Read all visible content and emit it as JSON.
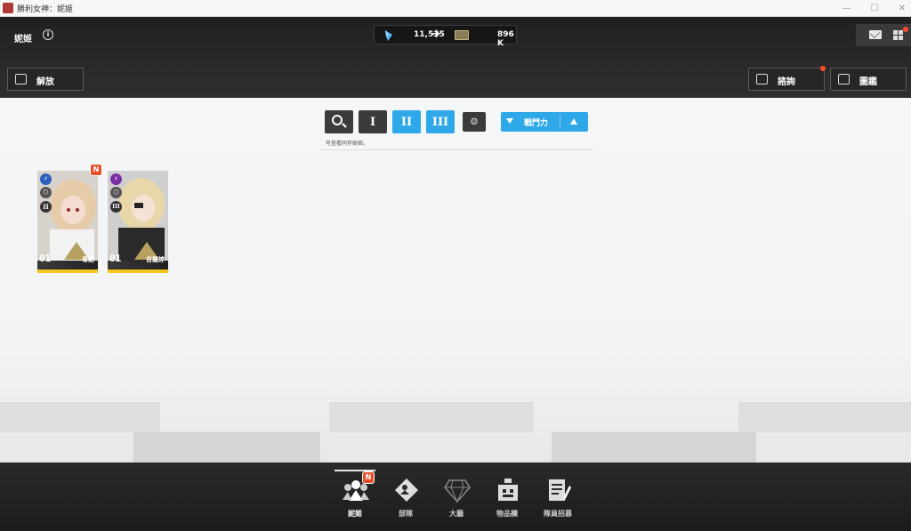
{
  "window": {
    "title": "勝利女神：妮姬"
  },
  "header": {
    "page_name": "妮姬",
    "gems": "11,535",
    "plus": "+",
    "tickets": "896 K"
  },
  "buttons": {
    "release": "解放",
    "inquiry": "諮詢",
    "codex": "圖鑑"
  },
  "filters": {
    "tier1": "I",
    "tier2": "II",
    "tier3": "III",
    "sort_label": "戰鬥力",
    "hint": "可查看同伴妮姬。"
  },
  "cards": [
    {
      "level": "01",
      "name": "毒蛇",
      "badge": "N",
      "burst": "II"
    },
    {
      "level": "01",
      "name": "吉羅婷",
      "burst": "III"
    }
  ],
  "nav": [
    {
      "label": "妮姬",
      "badge": "N"
    },
    {
      "label": "部隊"
    },
    {
      "label": "大廳"
    },
    {
      "label": "物品欄"
    },
    {
      "label": "隊員招募"
    }
  ],
  "colors": {
    "accent": "#2ea8e8",
    "dark_button": "#3b3b3b",
    "card_rarity": "#f2c61c",
    "notification": "#ff4a2e"
  }
}
